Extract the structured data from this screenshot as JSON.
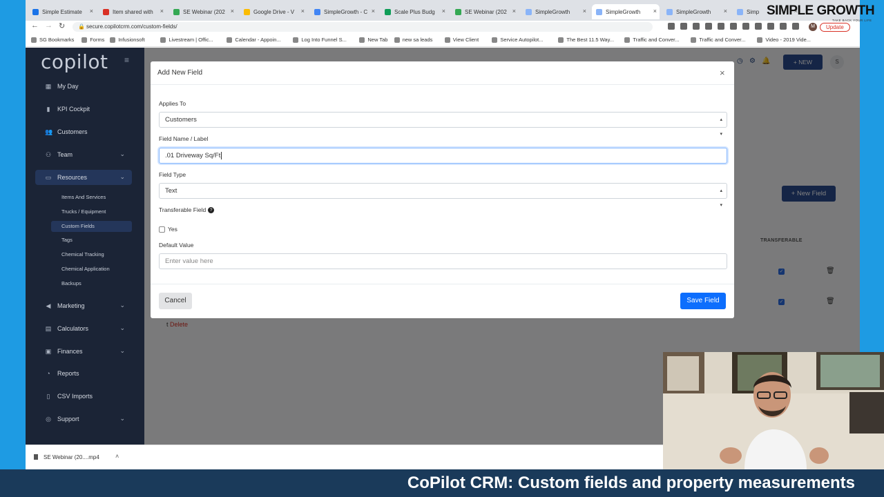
{
  "browser": {
    "tabs": [
      {
        "title": "Simple Estimate",
        "color": "#1a73e8",
        "active": false
      },
      {
        "title": "Item shared with",
        "color": "#d93025",
        "active": false
      },
      {
        "title": "SE Webinar (202",
        "color": "#34a853",
        "active": false
      },
      {
        "title": "Google Drive - V",
        "color": "#fbbc04",
        "active": false
      },
      {
        "title": "SimpleGrowth - C",
        "color": "#4285f4",
        "active": false
      },
      {
        "title": "Scale Plus Budg",
        "color": "#0f9d58",
        "active": false
      },
      {
        "title": "SE Webinar (202",
        "color": "#34a853",
        "active": false
      },
      {
        "title": "SimpleGrowth",
        "color": "#8ab4f8",
        "active": false
      },
      {
        "title": "SimpleGrowth",
        "color": "#8ab4f8",
        "active": true
      },
      {
        "title": "SimpleGrowth",
        "color": "#8ab4f8",
        "active": false
      },
      {
        "title": "Simp",
        "color": "#8ab4f8",
        "active": false
      }
    ],
    "url": "secure.copilotcrm.com/custom-fields/",
    "update_label": "Update",
    "profile_initial": "M",
    "bookmarks": [
      "SG Bookmarks",
      "Forms",
      "Infusionsoft",
      "Livestream | Offic...",
      "Calendar - Appoin...",
      "Log Into Funnel S...",
      "New Tab",
      "new sa leads",
      "View Client",
      "Service Autopilot...",
      "The Best 11.5 Way...",
      "Traffic and Conver...",
      "Traffic and Conver...",
      "Video - 2019 Vide..."
    ]
  },
  "app": {
    "logo": "copilot",
    "nav": [
      {
        "label": "My Day",
        "icon": "grid-icon",
        "glyph": "▦",
        "chevron": false,
        "open": false
      },
      {
        "label": "KPI Cockpit",
        "icon": "bar-chart-icon",
        "glyph": "▮",
        "chevron": false,
        "open": false
      },
      {
        "label": "Customers",
        "icon": "users-icon",
        "glyph": "👥",
        "chevron": false,
        "open": false
      },
      {
        "label": "Team",
        "icon": "team-icon",
        "glyph": "⚇",
        "chevron": true,
        "open": false
      },
      {
        "label": "Resources",
        "icon": "folder-icon",
        "glyph": "▭",
        "chevron": true,
        "open": true
      }
    ],
    "resources_sub": [
      {
        "label": "Items And Services",
        "active": false
      },
      {
        "label": "Trucks / Equipment",
        "active": false
      },
      {
        "label": "Custom Fields",
        "active": true
      },
      {
        "label": "Tags",
        "active": false
      },
      {
        "label": "Chemical Tracking",
        "active": false
      },
      {
        "label": "Chemical Application",
        "active": false
      },
      {
        "label": "Backups",
        "active": false
      }
    ],
    "nav_bottom": [
      {
        "label": "Marketing",
        "icon": "megaphone-icon",
        "glyph": "◀",
        "chevron": true
      },
      {
        "label": "Calculators",
        "icon": "calculator-icon",
        "glyph": "▤",
        "chevron": true
      },
      {
        "label": "Finances",
        "icon": "money-icon",
        "glyph": "▣",
        "chevron": true
      },
      {
        "label": "Reports",
        "icon": "reports-icon",
        "glyph": "◔",
        "chevron": false
      },
      {
        "label": "CSV Imports",
        "icon": "file-icon",
        "glyph": "▯",
        "chevron": false
      },
      {
        "label": "Support",
        "icon": "support-icon",
        "glyph": "◎",
        "chevron": true
      }
    ],
    "new_button": "+ NEW",
    "user_initial": "S",
    "new_field_button": "+ New Field",
    "column_transferable": "TRANSFERABLE",
    "delete_link": "Delete"
  },
  "modal": {
    "title": "Add New Field",
    "applies_to_label": "Applies To",
    "applies_to_value": "Customers",
    "field_name_label": "Field Name / Label",
    "field_name_value": ".01 Driveway Sq/Ft",
    "field_type_label": "Field Type",
    "field_type_value": "Text",
    "transferable_label": "Transferable Field",
    "transferable_option": "Yes",
    "transferable_checked": false,
    "default_value_label": "Default Value",
    "default_value_placeholder": "Enter value here",
    "cancel_label": "Cancel",
    "save_label": "Save Field"
  },
  "downloads": {
    "file": "SE Webinar (20....mp4"
  },
  "brand": {
    "name": "SIMPLE GROWTH",
    "tagline": "TAKE BACK YOUR LIFE"
  },
  "caption": "CoPilot CRM: Custom fields and property measurements",
  "colors": {
    "sidebar": "#1b2436",
    "accent_blue": "#0d6efd",
    "navy_button": "#2a4a8c",
    "video_frame": "#1e9be3",
    "caption_bar": "#1a3a5a"
  }
}
